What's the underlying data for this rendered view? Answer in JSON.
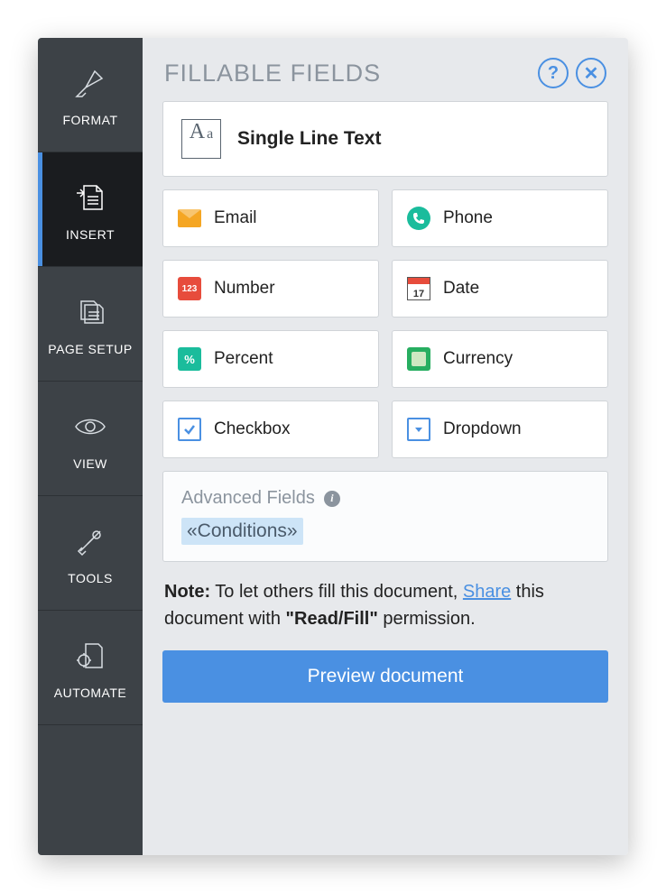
{
  "sidebar": {
    "items": [
      {
        "label": "FORMAT"
      },
      {
        "label": "INSERT"
      },
      {
        "label": "PAGE SETUP"
      },
      {
        "label": "VIEW"
      },
      {
        "label": "TOOLS"
      },
      {
        "label": "AUTOMATE"
      }
    ]
  },
  "panel": {
    "title": "FILLABLE FIELDS",
    "help_label": "?",
    "close_label": "✕"
  },
  "fields": {
    "single_line": "Single Line Text",
    "email": "Email",
    "phone": "Phone",
    "number": "Number",
    "date": "Date",
    "percent": "Percent",
    "currency": "Currency",
    "checkbox": "Checkbox",
    "dropdown": "Dropdown",
    "number_badge": "123",
    "date_badge": "17",
    "percent_badge": "%"
  },
  "advanced": {
    "title": "Advanced Fields",
    "conditions": "«Conditions»"
  },
  "note": {
    "prefix": "Note:",
    "text1": " To let others fill this document, ",
    "link": "Share",
    "text2": " this document with ",
    "perm": "\"Read/Fill\"",
    "text3": " permission."
  },
  "preview_btn": "Preview document"
}
